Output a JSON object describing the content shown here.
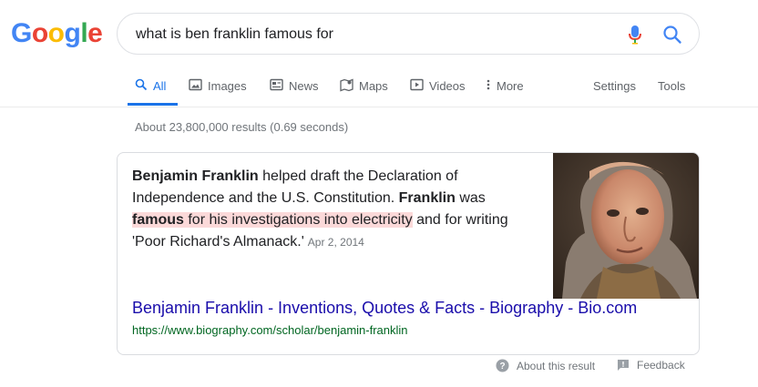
{
  "logo": {
    "letters": [
      "G",
      "o",
      "o",
      "g",
      "l",
      "e"
    ],
    "colors": [
      "#4285F4",
      "#EA4335",
      "#FBBC05",
      "#4285F4",
      "#34A853",
      "#EA4335"
    ]
  },
  "search": {
    "query": "what is ben franklin famous for"
  },
  "tabs": [
    {
      "label": "All",
      "icon": "search-icon"
    },
    {
      "label": "Images",
      "icon": "image-icon"
    },
    {
      "label": "News",
      "icon": "news-icon"
    },
    {
      "label": "Maps",
      "icon": "map-icon"
    },
    {
      "label": "Videos",
      "icon": "video-icon"
    },
    {
      "label": "More",
      "icon": "more-vert-icon"
    }
  ],
  "tools": {
    "settings": "Settings",
    "tools": "Tools"
  },
  "result_stats": "About 23,800,000 results (0.69 seconds)",
  "featured_snippet": {
    "parts": {
      "p1": "Benjamin Franklin",
      "p2": " helped draft the Declaration of Independence and the U.S. Constitution. ",
      "p3": "Franklin",
      "p4": " was ",
      "p5": "famous",
      "p6": " for his investigations into electricity",
      "p7": " and for writing 'Poor Richard's Almanack.'"
    },
    "date": "Apr 2, 2014",
    "link_title": "Benjamin Franklin - Inventions, Quotes & Facts - Biography - Bio.com",
    "link_url": "https://www.biography.com/scholar/benjamin-franklin"
  },
  "footer": {
    "about": "About this result",
    "feedback": "Feedback"
  },
  "colors": {
    "accent": "#1a73e8",
    "link": "#1a0dab",
    "url": "#006621",
    "highlight": "#fbd9d9"
  }
}
